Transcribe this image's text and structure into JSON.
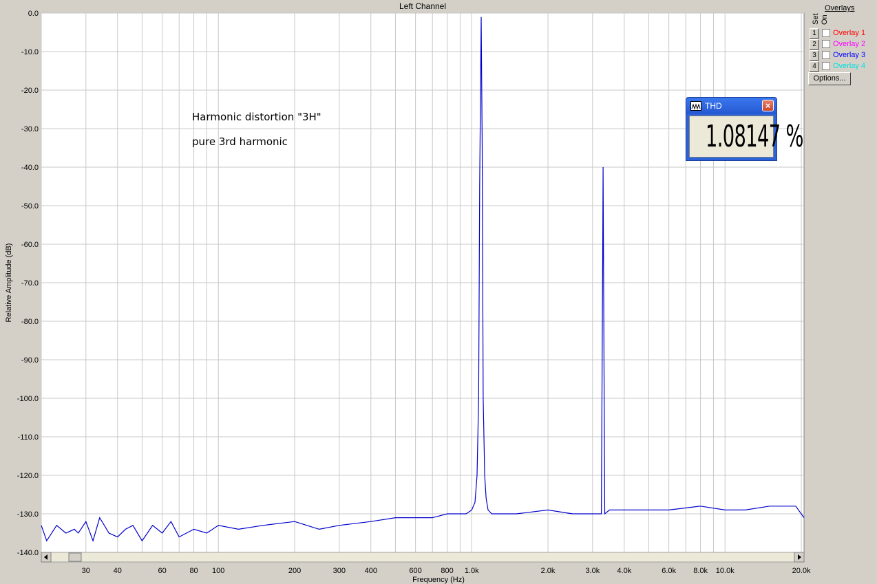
{
  "window": {
    "overlays_title": "Overlays",
    "set_header": "Set",
    "on_header": "On",
    "overlays": [
      {
        "set": "1",
        "label": "Overlay 1",
        "color": "#ff0000"
      },
      {
        "set": "2",
        "label": "Overlay 2",
        "color": "#ff00ff"
      },
      {
        "set": "3",
        "label": "Overlay 3",
        "color": "#0000ff"
      },
      {
        "set": "4",
        "label": "Overlay 4",
        "color": "#00e0e0"
      }
    ],
    "options_label": "Options...",
    "thd": {
      "title": "THD",
      "value": "1.08147 %",
      "close": "×"
    }
  },
  "chart_data": {
    "type": "line",
    "title": "Left Channel",
    "xlabel": "Frequency (Hz)",
    "ylabel": "Relative Amplitude (dB)",
    "xscale": "log",
    "xlim": [
      20,
      20500
    ],
    "ylim": [
      -140,
      0
    ],
    "grid": true,
    "line_color": "#0000cc",
    "ytick_labels": [
      "0.0",
      "-10.0",
      "-20.0",
      "-30.0",
      "-40.0",
      "-50.0",
      "-60.0",
      "-70.0",
      "-80.0",
      "-90.0",
      "-100.0",
      "-110.0",
      "-120.0",
      "-130.0",
      "-140.0"
    ],
    "ytick_values": [
      0,
      -10,
      -20,
      -30,
      -40,
      -50,
      -60,
      -70,
      -80,
      -90,
      -100,
      -110,
      -120,
      -130,
      -140
    ],
    "xtick_labels": [
      {
        "v": 30,
        "t": "30"
      },
      {
        "v": 40,
        "t": "40"
      },
      {
        "v": 60,
        "t": "60"
      },
      {
        "v": 80,
        "t": "80"
      },
      {
        "v": 100,
        "t": "100"
      },
      {
        "v": 200,
        "t": "200"
      },
      {
        "v": 300,
        "t": "300"
      },
      {
        "v": 400,
        "t": "400"
      },
      {
        "v": 600,
        "t": "600"
      },
      {
        "v": 800,
        "t": "800"
      },
      {
        "v": 1000,
        "t": "1.0k"
      },
      {
        "v": 2000,
        "t": "2.0k"
      },
      {
        "v": 3000,
        "t": "3.0k"
      },
      {
        "v": 4000,
        "t": "4.0k"
      },
      {
        "v": 6000,
        "t": "6.0k"
      },
      {
        "v": 8000,
        "t": "8.0k"
      },
      {
        "v": 10000,
        "t": "10.0k"
      },
      {
        "v": 20000,
        "t": "20.0k"
      }
    ],
    "annotations": [
      "Harmonic distortion \"3H\"",
      "pure 3rd harmonic"
    ],
    "series": [
      {
        "x": [
          20,
          21,
          23,
          25,
          27,
          28,
          30,
          32,
          34,
          37,
          40,
          43,
          46,
          50,
          55,
          60,
          65,
          70,
          80,
          90,
          100,
          120,
          150,
          200,
          250,
          300,
          400,
          500,
          600,
          700,
          800,
          900,
          950,
          1000,
          1030,
          1050,
          1065,
          1075,
          1090,
          1100,
          1110,
          1125,
          1140,
          1160,
          1200,
          1300,
          1500,
          2000,
          2500,
          3000,
          3250,
          3290,
          3300,
          3310,
          3350,
          3500,
          4000,
          5000,
          6000,
          8000,
          10000,
          12000,
          15000,
          17000,
          19000,
          20500
        ],
        "y": [
          -133,
          -137,
          -133,
          -135,
          -134,
          -135,
          -132,
          -137,
          -131,
          -135,
          -136,
          -134,
          -133,
          -137,
          -133,
          -135,
          -132,
          -136,
          -134,
          -135,
          -133,
          -134,
          -133,
          -132,
          -134,
          -133,
          -132,
          -131,
          -131,
          -131,
          -130,
          -130,
          -130,
          -129,
          -127,
          -120,
          -100,
          -45,
          -1,
          -35,
          -100,
          -120,
          -126,
          -129,
          -130,
          -130,
          -130,
          -129,
          -130,
          -130,
          -130,
          -60,
          -40,
          -60,
          -130,
          -129,
          -129,
          -129,
          -129,
          -128,
          -129,
          -129,
          -128,
          -128,
          -128,
          -131
        ]
      }
    ]
  }
}
